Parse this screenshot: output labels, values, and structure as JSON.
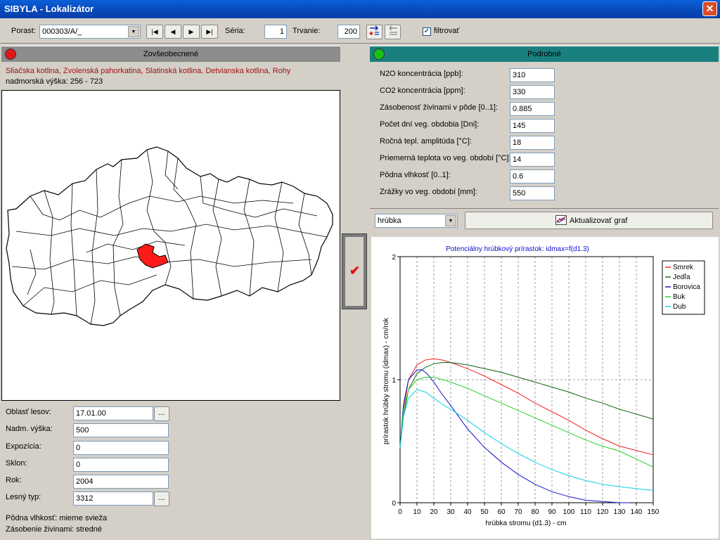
{
  "window": {
    "title": "SIBYLA - Lokalizátor",
    "close_glyph": "✕"
  },
  "toolbar": {
    "porast_label": "Porast:",
    "porast_value": "000303/A/_",
    "nav": {
      "first": "|◀",
      "prev": "◀",
      "next": "▶",
      "last": "▶|"
    },
    "seria_label": "Séria:",
    "seria_value": "1",
    "trvanie_label": "Trvanie:",
    "trvanie_value": "200",
    "filter_label": "filtrovať",
    "filter_checked": true
  },
  "left_panel": {
    "header": "Zovšeobecnené",
    "status_color": "#e01818",
    "regions": "Sliačska kotlina, Zvolenská pahorkatina, Slatinská kotlina, Detvianska kotlina, Rohy",
    "altitude": "nadmorská výška: 256 - 723",
    "fields": [
      {
        "label": "Oblasť lesov:",
        "value": "17.01.00",
        "has_button": true
      },
      {
        "label": "Nadm. výška:",
        "value": "500",
        "has_button": false
      },
      {
        "label": "Expozícia:",
        "value": "0",
        "has_button": false
      },
      {
        "label": "Sklon:",
        "value": "0",
        "has_button": false
      },
      {
        "label": "Rok:",
        "value": "2004",
        "has_button": false
      },
      {
        "label": "Lesný typ:",
        "value": "3312",
        "has_button": true
      }
    ],
    "dots_label": "...",
    "soil_moisture": "Pôdna vlhkosť: mierne svieža",
    "nutrients": "Zásobenie živinami: stredné"
  },
  "apply_button": {
    "glyph": "✔"
  },
  "right_panel": {
    "header": "Podrobné",
    "status_color": "#18c018",
    "params": [
      {
        "label": "N2O koncentrácia [ppb]:",
        "value": "310"
      },
      {
        "label": "CO2 koncentrácia [ppm]:",
        "value": "330"
      },
      {
        "label": "Zásobenosť živinami v pôde [0..1]:",
        "value": "0.885"
      },
      {
        "label": "Počet dní veg. obdobia [Dni]:",
        "value": "145"
      },
      {
        "label": "Ročná tepl. amplitúda [°C]:",
        "value": "18"
      },
      {
        "label": "Priemerná teplota vo veg. období [°C]:",
        "value": "14"
      },
      {
        "label": "Pôdna vlhkosť [0..1]:",
        "value": "0.6"
      },
      {
        "label": "Zrážky vo veg. období [mm]:",
        "value": "550"
      }
    ],
    "graph_select": "hrúbka",
    "update_label": "Aktualizovať graf"
  },
  "chart_data": {
    "type": "line",
    "title": "Potenciálny hrúbkový prírastok: idmax=f(d1.3)",
    "xlabel": "hrúbka stromu (d1.3) - cm",
    "ylabel": "prírastok hrúbky stromu (idmax) - cm/rok",
    "xlim": [
      0,
      150
    ],
    "ylim": [
      0,
      2
    ],
    "xticks": [
      0,
      10,
      20,
      30,
      40,
      50,
      60,
      70,
      80,
      90,
      100,
      110,
      120,
      130,
      140,
      150
    ],
    "yticks": [
      0,
      1,
      2
    ],
    "grid": "vertical dashed + y=1 dashed",
    "legend_position": "top-right",
    "series": [
      {
        "name": "Smrek",
        "color": "#ee2020",
        "x": [
          0,
          2,
          5,
          10,
          15,
          20,
          25,
          30,
          40,
          50,
          60,
          70,
          80,
          90,
          100,
          110,
          120,
          130,
          150
        ],
        "y": [
          0.45,
          0.75,
          1.0,
          1.12,
          1.16,
          1.17,
          1.16,
          1.14,
          1.09,
          1.03,
          0.96,
          0.89,
          0.81,
          0.74,
          0.67,
          0.59,
          0.52,
          0.46,
          0.39
        ]
      },
      {
        "name": "Jedľa",
        "color": "#106010",
        "x": [
          0,
          2,
          5,
          10,
          15,
          20,
          25,
          30,
          40,
          50,
          60,
          70,
          80,
          90,
          100,
          110,
          120,
          130,
          150
        ],
        "y": [
          0.45,
          0.7,
          0.92,
          1.05,
          1.1,
          1.13,
          1.14,
          1.14,
          1.12,
          1.09,
          1.06,
          1.02,
          0.98,
          0.94,
          0.9,
          0.85,
          0.81,
          0.76,
          0.68
        ]
      },
      {
        "name": "Borovica",
        "color": "#1010cc",
        "x": [
          0,
          2,
          5,
          10,
          13,
          16,
          20,
          25,
          30,
          40,
          50,
          60,
          70,
          80,
          90,
          100,
          110,
          120,
          130,
          136
        ],
        "y": [
          0.45,
          0.8,
          1.0,
          1.08,
          1.08,
          1.05,
          0.98,
          0.88,
          0.79,
          0.6,
          0.45,
          0.33,
          0.23,
          0.15,
          0.09,
          0.05,
          0.02,
          0.01,
          0.0,
          0.0
        ]
      },
      {
        "name": "Buk",
        "color": "#20d020",
        "x": [
          0,
          2,
          5,
          10,
          15,
          20,
          25,
          30,
          40,
          50,
          60,
          70,
          80,
          90,
          100,
          110,
          120,
          130,
          150
        ],
        "y": [
          0.45,
          0.75,
          0.92,
          1.0,
          1.02,
          1.02,
          1.0,
          0.98,
          0.93,
          0.87,
          0.81,
          0.75,
          0.69,
          0.63,
          0.57,
          0.51,
          0.46,
          0.42,
          0.29
        ]
      },
      {
        "name": "Dub",
        "color": "#10d0e0",
        "x": [
          0,
          2,
          5,
          10,
          15,
          20,
          25,
          30,
          40,
          50,
          60,
          70,
          80,
          90,
          100,
          110,
          120,
          130,
          150
        ],
        "y": [
          0.45,
          0.7,
          0.85,
          0.92,
          0.9,
          0.85,
          0.8,
          0.76,
          0.67,
          0.57,
          0.48,
          0.4,
          0.33,
          0.27,
          0.22,
          0.18,
          0.15,
          0.13,
          0.1
        ]
      }
    ]
  }
}
